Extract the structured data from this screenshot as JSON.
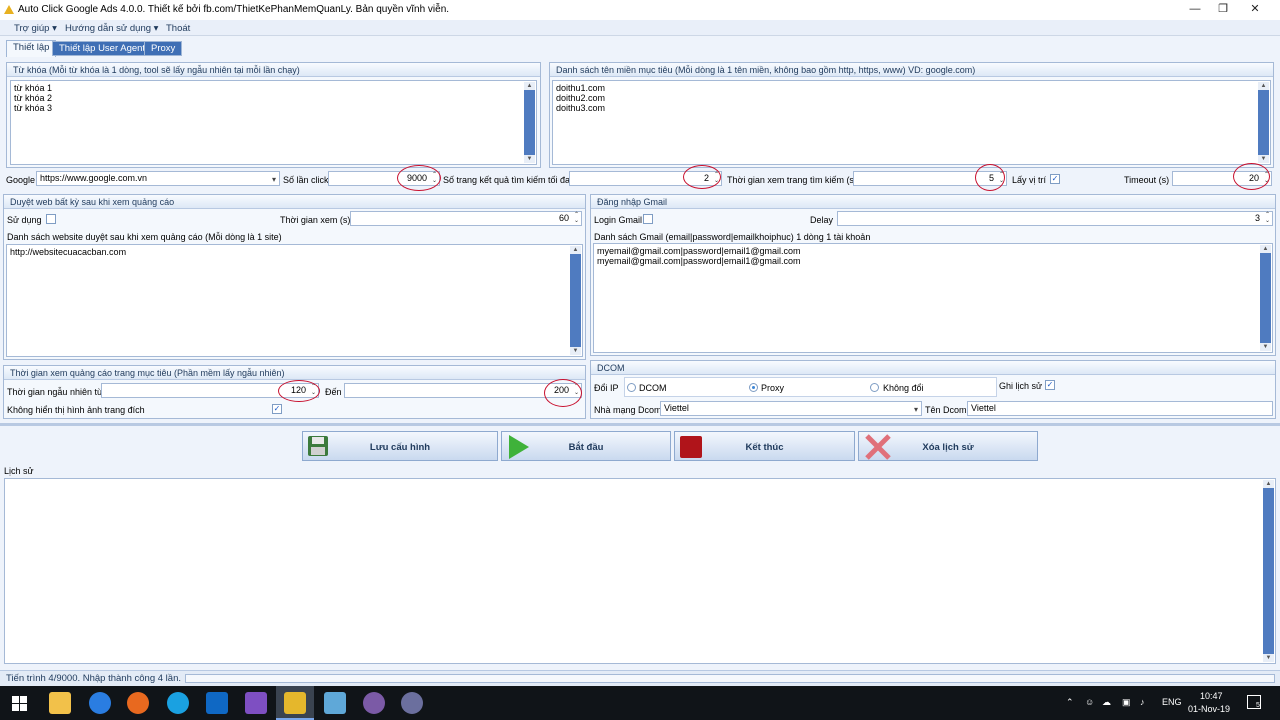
{
  "window": {
    "title": "Auto Click Google Ads 4.0.0. Thiết kế bởi fb.com/ThietKePhanMemQuanLy. Bản quyền vĩnh viễn.",
    "controls": [
      "—",
      "❐",
      "✕"
    ]
  },
  "menu": [
    "Trợ giúp ▾",
    "Hướng dẫn sử dụng ▾",
    "Thoát"
  ],
  "tabs": [
    "Thiết lập",
    "Thiết lập User Agent",
    "Proxy"
  ],
  "keywords": {
    "header": "Từ khóa (Mỗi từ khóa là 1 dòng, tool sẽ lấy ngẫu nhiên tại mỗi lần chạy)",
    "lines": [
      "từ khóa 1",
      "từ khóa 2",
      "từ khóa 3"
    ]
  },
  "domains": {
    "header": "Danh sách tên miền mục tiêu (Mỗi dòng là 1 tên miền, không bao gồm http, https, www) VD: google.com)",
    "lines": [
      "doithu1.com",
      "doithu2.com",
      "doithu3.com"
    ]
  },
  "settings_row": {
    "google_label": "Google",
    "google_value": "https://www.google.com.vn",
    "clicks_label": "Số lần click",
    "clicks_value": "9000",
    "max_pages_label": "Số trang kết quả tìm kiếm tối đa",
    "max_pages_value": "2",
    "view_time_label": "Thời gian xem trang tìm kiếm (s)",
    "view_time_value": "5",
    "location_label": "Lấy vị trí",
    "location_checked": "✓",
    "timeout_label": "Timeout (s)",
    "timeout_value": "20"
  },
  "browse": {
    "header": "Duyệt web bất kỳ sau khi xem quảng cáo",
    "use_label": "Sử dụng",
    "view_time_label": "Thời gian xem (s)",
    "view_time_value": "60",
    "list_label": "Danh sách website duyệt sau khi xem quảng cáo (Mỗi dòng là 1 site)",
    "lines": [
      "http://websitecuacacban.com"
    ]
  },
  "gmail": {
    "header": "Đăng nhập Gmail",
    "login_label": "Login Gmail",
    "delay_label": "Delay",
    "delay_value": "3",
    "list_label": "Danh sách Gmail (email|password|emailkhoiphuc) 1 dòng 1 tài khoản",
    "lines": [
      "myemail@gmail.com|password|email1@gmail.com",
      "myemail@gmail.com|password|email1@gmail.com"
    ]
  },
  "ad_time": {
    "header": "Thời gian xem quảng cáo trang mục tiêu (Phần mềm lấy ngẫu nhiên)",
    "random_label": "Thời gian ngẫu nhiên từ",
    "from_value": "120",
    "to_label": "Đến",
    "to_value": "200",
    "no_images_label": "Không hiển thị hình ảnh trang đích",
    "no_images_checked": "✓"
  },
  "dcom": {
    "header": "DCOM",
    "ip_label": "Đổi IP",
    "options": [
      "DCOM",
      "Proxy",
      "Không đổi"
    ],
    "selected": "Proxy",
    "history_label": "Ghi lịch sử",
    "history_checked": "✓",
    "carrier_label": "Nhà mạng Dcom",
    "carrier_value": "Viettel",
    "name_label": "Tên Dcom",
    "name_value": "Viettel"
  },
  "actions": [
    "Lưu cấu hình",
    "Bắt đầu",
    "Kết thúc",
    "Xóa lịch sử"
  ],
  "history_label": "Lịch sử",
  "status": "Tiến trình 4/9000. Nhập thành công 4 lần.",
  "taskbar": {
    "lang": "ENG",
    "time": "10:47",
    "date": "01-Nov-19",
    "notification": "5",
    "app_icon_names": [
      "windows-start-icon",
      "file-explorer-icon",
      "zalo-icon",
      "firefox-icon",
      "skype-icon",
      "outlook-icon",
      "visual-studio-icon",
      "active-app-icon",
      "notepad-icon",
      "browser-icon-1",
      "browser-icon-2"
    ]
  },
  "colors": {
    "accent": "#3f6fb5",
    "panel_border": "#a5b9d6",
    "highlight_ring": "#c8102e",
    "start_green": "#3fb23a",
    "stop_red": "#b0141a"
  }
}
